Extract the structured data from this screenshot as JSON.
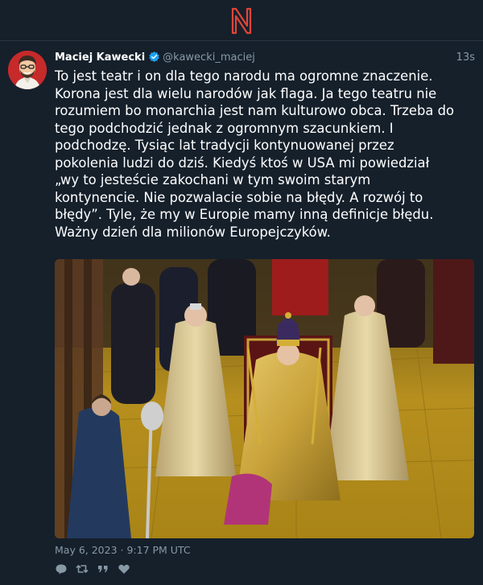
{
  "app": {
    "logo_letter": "N",
    "logo_color": "#e0453a"
  },
  "tweet": {
    "author_name": "Maciej Kawecki",
    "author_handle": "@kawecki_maciej",
    "verified": true,
    "relative_time": "13s",
    "text": "To jest teatr i on dla tego narodu ma ogromne znaczenie. Korona jest dla wielu narodów jak flaga. Ja tego teatru nie rozumiem bo monarchia jest nam kulturowo obca. Trzeba do tego podchodzić jednak z ogromnym szacunkiem. I podchodzę. Tysiąc lat tradycji kontynuowanej przez pokolenia ludzi do dziś. Kiedyś ktoś w USA mi powiedział „wy to jesteście zakochani w tym swoim starym kontynencie. Nie pozwalacie sobie na błędy. A rozwój to błędy”. Tyle, że my w Europie mamy inną definicje błędu. Ważny dzień dla milionów Europejczyków.",
    "timestamp": "May 6, 2023 · 9:17 PM UTC",
    "actions": [
      "reply-icon",
      "retweet-icon",
      "quote-icon",
      "like-icon"
    ]
  },
  "colors": {
    "background": "#15202b",
    "muted_text": "#8899a6",
    "verified_blue": "#1da1f2",
    "avatar_bg": "#c62a2a"
  }
}
